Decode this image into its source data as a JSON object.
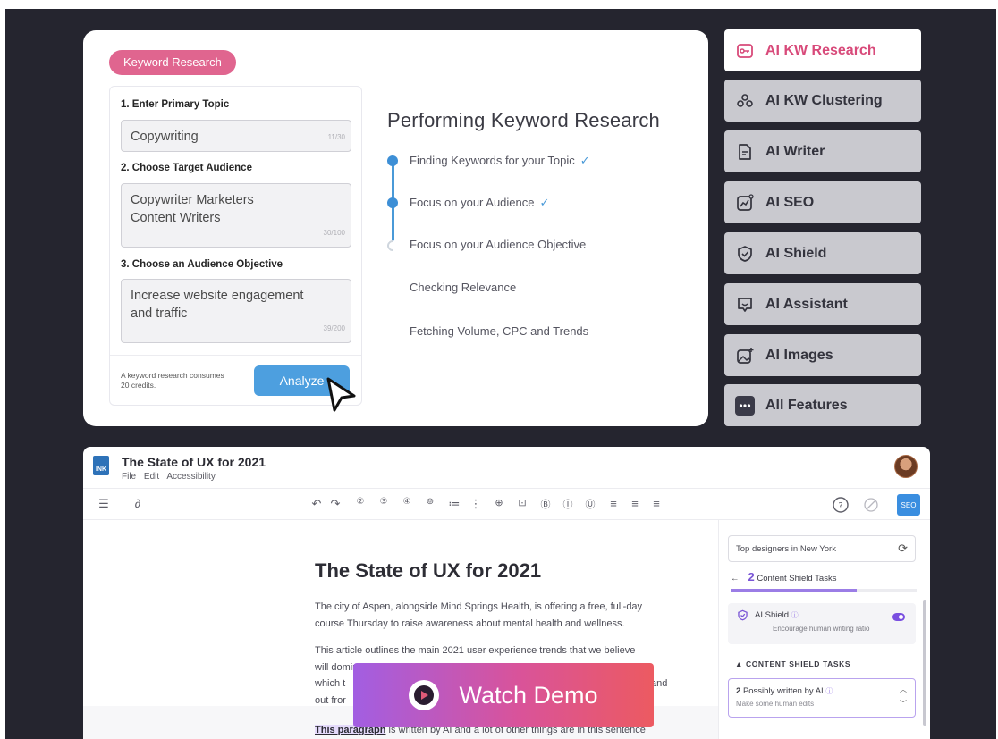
{
  "colors": {
    "background": "#25252f",
    "accent_pink": "#d84a7a",
    "accent_blue": "#4d9fdf",
    "accent_purple": "#7a55d6"
  },
  "keyword_card": {
    "pill": "Keyword Research",
    "step1_label": "1. Enter Primary Topic",
    "topic_value": "Copywriting",
    "topic_counter": "11/30",
    "step2_label": "2. Choose Target Audience",
    "audience_line1": "Copywriter  Marketers",
    "audience_line2": "Content Writers",
    "audience_counter": "30/100",
    "step3_label": "3. Choose an Audience Objective",
    "objective_line1": "Increase website engagement",
    "objective_line2": "and traffic",
    "objective_counter": "39/200",
    "credits_note": "A keyword research consumes 20 credits.",
    "analyze_label": "Analyze",
    "progress_title": "Performing Keyword Research",
    "steps": [
      {
        "label": "Finding Keywords for your Topic",
        "check": "✓"
      },
      {
        "label": "Focus on your Audience",
        "check": "✓"
      },
      {
        "label": "Focus on your Audience Objective",
        "check": ""
      },
      {
        "label": "Checking Relevance",
        "check": ""
      },
      {
        "label": "Fetching Volume, CPC and Trends",
        "check": ""
      }
    ]
  },
  "side_menu": {
    "items": [
      {
        "label": "AI KW Research",
        "icon": "key-icon",
        "active": true
      },
      {
        "label": "AI KW Clustering",
        "icon": "cluster-icon",
        "active": false
      },
      {
        "label": "AI Writer",
        "icon": "document-icon",
        "active": false
      },
      {
        "label": "AI SEO",
        "icon": "seo-chart-icon",
        "active": false
      },
      {
        "label": "AI Shield",
        "icon": "shield-icon",
        "active": false
      },
      {
        "label": "AI Assistant",
        "icon": "chat-icon",
        "active": false
      },
      {
        "label": "AI Images",
        "icon": "image-icon",
        "active": false
      },
      {
        "label": "All Features",
        "icon": "more-icon",
        "active": false
      }
    ]
  },
  "editor": {
    "logo_text": "INK",
    "doc_title": "The State of UX for 2021",
    "menu": [
      "File",
      "Edit",
      "Accessibility"
    ],
    "seo_label": "SEO",
    "article_title": "The State of UX for 2021",
    "para1_line1": "The city of Aspen, alongside Mind Springs Health, is offering a free, full-day",
    "para1_line2": "course Thursday to raise awareness about mental health and wellness.",
    "para2_line1": "This article outlines the main 2021 user experience trends that we believe",
    "para2_line2": "will dominate and are likely to shape the year to come. Take a look and see",
    "para2_line3a": "which t",
    "para2_line3b": "and",
    "para2_line4": "out fror",
    "para3_highlight": "This paragraph",
    "para3_rest": " is written by AI and a lot of other things are in this sentence",
    "panel": {
      "search_value": "Top designers in New York",
      "tasks_count": "2",
      "tasks_label": "Content Shield Tasks",
      "tasks_progress": 0.68,
      "shield_title": "AI Shield",
      "shield_info": "ⓘ",
      "shield_sub": "Encourage human writing ratio",
      "section_title": "▲  CONTENT SHIELD TASKS",
      "task_count": "2",
      "task_title": "Possibly written by AI",
      "task_info": "ⓘ",
      "task_sub": "Make some human edits"
    }
  },
  "watch_demo": "Watch Demo"
}
